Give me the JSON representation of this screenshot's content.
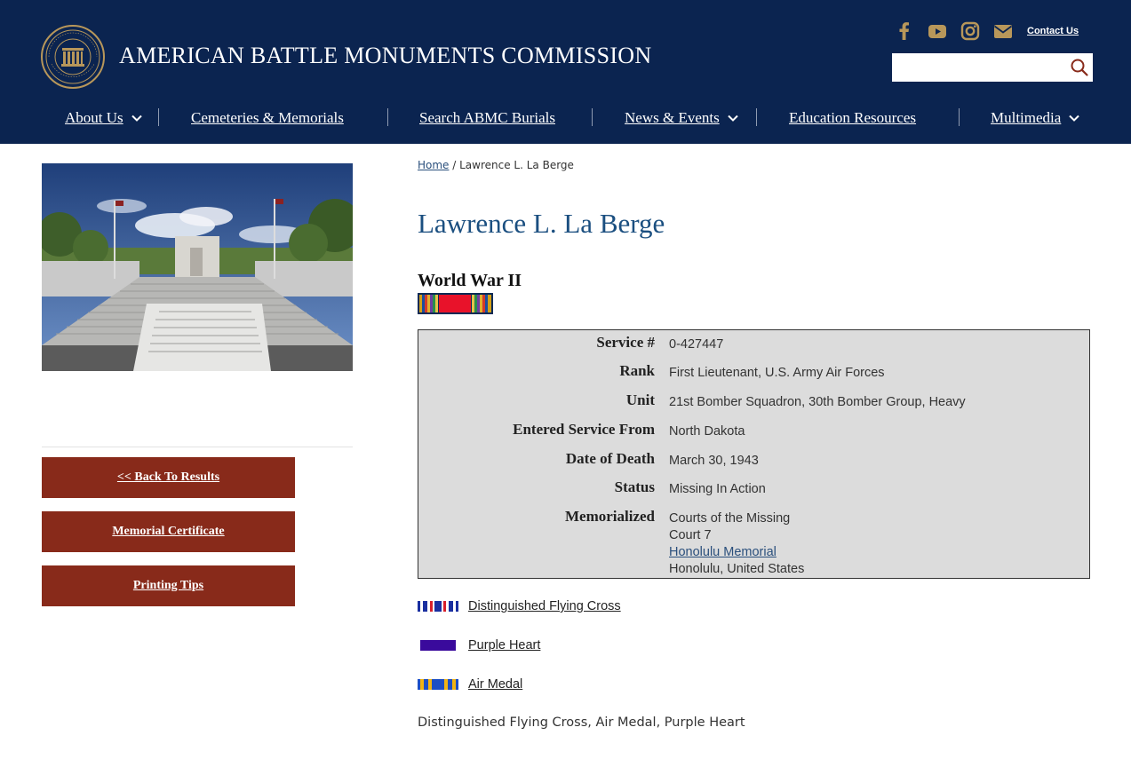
{
  "header": {
    "site_title": "AMERICAN BATTLE MONUMENTS COMMISSION",
    "contact_label": "Contact Us",
    "search_placeholder": "",
    "social_icons": [
      "facebook-icon",
      "youtube-icon",
      "instagram-icon",
      "email-icon"
    ]
  },
  "nav": {
    "items": [
      {
        "label": "About Us",
        "dropdown": true
      },
      {
        "label": "Cemeteries & Memorials",
        "dropdown": false
      },
      {
        "label": "Search ABMC Burials",
        "dropdown": false
      },
      {
        "label": "News & Events",
        "dropdown": true
      },
      {
        "label": "Education Resources",
        "dropdown": false
      },
      {
        "label": "Multimedia",
        "dropdown": true
      }
    ]
  },
  "sidebar": {
    "buttons": [
      {
        "label": "<< Back To Results"
      },
      {
        "label": "Memorial Certificate"
      },
      {
        "label": "Printing Tips"
      }
    ]
  },
  "breadcrumb": {
    "home": "Home",
    "separator": " / ",
    "current": "Lawrence L. La Berge"
  },
  "record": {
    "name": "Lawrence L. La Berge",
    "war": "World War II",
    "fields": [
      {
        "label": "Service #",
        "value": "0-427447"
      },
      {
        "label": "Rank",
        "value": "First Lieutenant, U.S. Army Air Forces"
      },
      {
        "label": "Unit",
        "value": "21st Bomber Squadron, 30th Bomber Group, Heavy"
      },
      {
        "label": "Entered Service From",
        "value": "North Dakota"
      },
      {
        "label": "Date of Death",
        "value": "March 30, 1943"
      },
      {
        "label": "Status",
        "value": "Missing In Action"
      }
    ],
    "memorialized": {
      "label": "Memorialized",
      "line1": "Courts of the Missing",
      "line2": "Court 7",
      "memorial_link": "Honolulu Memorial",
      "location": "Honolulu, United States"
    }
  },
  "awards": {
    "items": [
      {
        "label": "Distinguished Flying Cross"
      },
      {
        "label": "Purple Heart"
      },
      {
        "label": "Air Medal"
      }
    ],
    "summary": "Distinguished Flying Cross, Air Medal, Purple Heart"
  },
  "colors": {
    "header_bg": "#0b2450",
    "accent_gold": "#b8975a",
    "button_bg": "#882a1a",
    "name_blue": "#1b4f80",
    "info_bg": "#dcdcdc"
  }
}
